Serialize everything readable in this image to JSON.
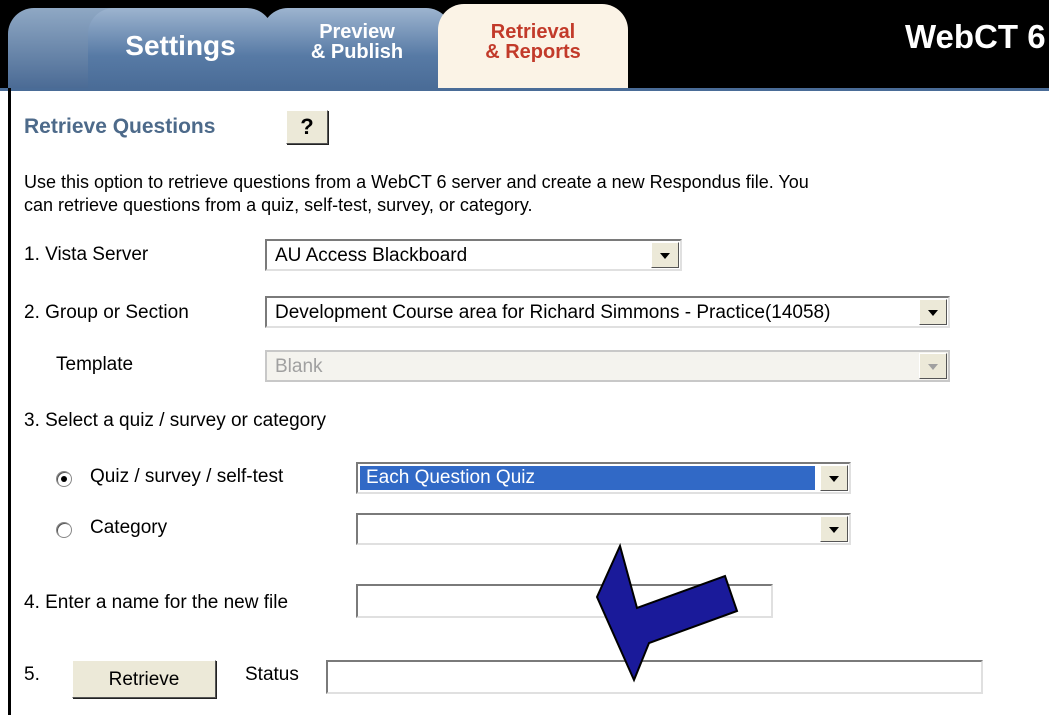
{
  "tabs": {
    "settings": "Settings",
    "preview_line1": "Preview",
    "preview_line2": "& Publish",
    "retrieval_line1": "Retrieval",
    "retrieval_line2": "& Reports"
  },
  "brand": "WebCT 6",
  "heading": "Retrieve Questions",
  "help_label": "?",
  "intro": {
    "line1": "Use this option to retrieve questions from a WebCT 6 server and create a new Respondus file.  You",
    "line2": "can retrieve questions from a quiz, self-test, survey, or category."
  },
  "form": {
    "step1_label": "1. Vista Server",
    "server_value": "AU Access Blackboard",
    "step2_label": "2. Group or Section",
    "group_value": "Development Course area for Richard Simmons - Practice(14058)",
    "template_label": "Template",
    "template_value": "Blank",
    "step3_label": "3. Select a quiz / survey or category",
    "quiz_radio_label": "Quiz / survey / self-test",
    "quiz_value": "Each Question Quiz",
    "category_radio_label": "Category",
    "category_value": "",
    "step4_label": "4. Enter a name for the new file",
    "name_value": "",
    "step5_label": "5.",
    "retrieve_label": "Retrieve",
    "status_label": "Status",
    "status_value": ""
  },
  "colors": {
    "tab_blue": "#577aa5",
    "active_tab": "#fbf3e6",
    "active_tab_text": "#c23a2a",
    "heading_text": "#4d6a8a",
    "selection_highlight": "#3169c6",
    "annotation_arrow": "#1a1a9a"
  },
  "annotation": {
    "icon": "pointer-arrow-icon"
  }
}
